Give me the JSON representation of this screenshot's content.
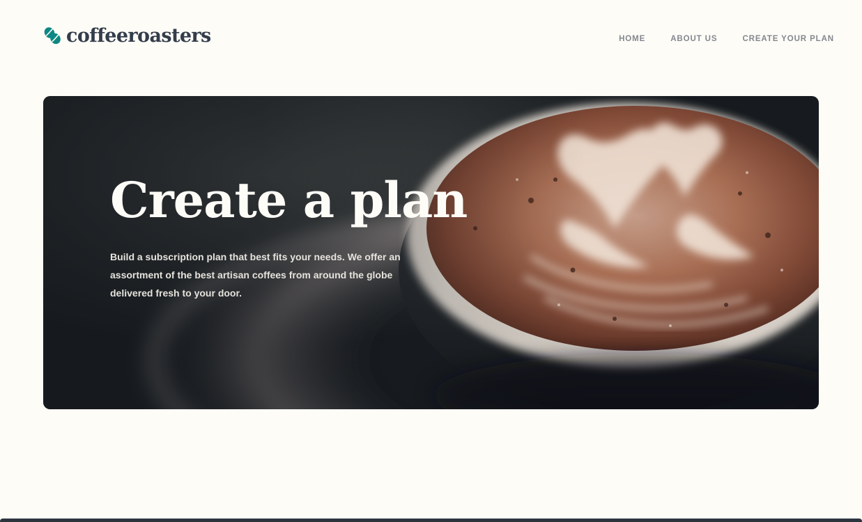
{
  "header": {
    "logo_text": "coffeeroasters",
    "nav": [
      {
        "label": "HOME"
      },
      {
        "label": "ABOUT US"
      },
      {
        "label": "CREATE YOUR PLAN"
      }
    ]
  },
  "hero": {
    "title": "Create a plan",
    "description": "Build a subscription plan that best fits your needs. We offer an assortment of the best artisan coffees from around the globe delivered fresh to your door."
  },
  "colors": {
    "background": "#FEFCF7",
    "logo_text": "#333D4B",
    "logo_mark": "#0E8784",
    "nav_text": "#83888F",
    "hero_text": "#FEFCF7",
    "footer": "#2C343E"
  },
  "icons": {
    "logo": "coffee-bean-icon"
  }
}
